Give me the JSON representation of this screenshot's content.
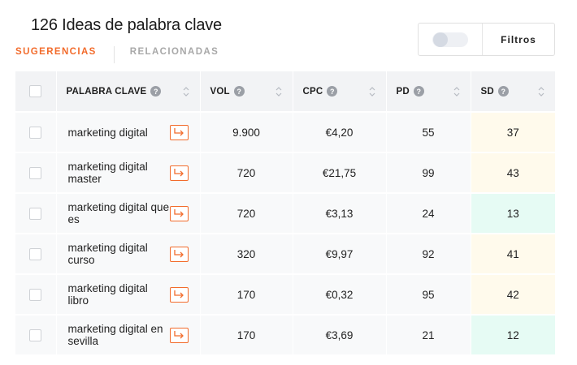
{
  "header": {
    "title": "126 Ideas de palabra clave"
  },
  "tabs": [
    {
      "label": "SUGERENCIAS",
      "active": true
    },
    {
      "label": "RELACIONADAS",
      "active": false
    }
  ],
  "filters": {
    "label": "Filtros",
    "toggle_on": false
  },
  "table": {
    "columns": [
      "PALABRA CLAVE",
      "VOL",
      "CPC",
      "PD",
      "SD"
    ],
    "rows": [
      {
        "keyword": "marketing digital",
        "vol": "9.900",
        "cpc": "€4,20",
        "pd": "55",
        "sd": "37",
        "sd_color": "#fffaec"
      },
      {
        "keyword": "marketing digital master",
        "vol": "720",
        "cpc": "€21,75",
        "pd": "99",
        "sd": "43",
        "sd_color": "#fffaec"
      },
      {
        "keyword": "marketing digital que es",
        "vol": "720",
        "cpc": "€3,13",
        "pd": "24",
        "sd": "13",
        "sd_color": "#e6fbf4"
      },
      {
        "keyword": "marketing digital curso",
        "vol": "320",
        "cpc": "€9,97",
        "pd": "92",
        "sd": "41",
        "sd_color": "#fffaec"
      },
      {
        "keyword": "marketing digital libro",
        "vol": "170",
        "cpc": "€0,32",
        "pd": "95",
        "sd": "42",
        "sd_color": "#fffaec"
      },
      {
        "keyword": "marketing digital en sevilla",
        "vol": "170",
        "cpc": "€3,69",
        "pd": "21",
        "sd": "12",
        "sd_color": "#e6fbf4"
      }
    ]
  },
  "colors": {
    "accent": "#f26b2b",
    "sd_medium": "#fffaec",
    "sd_easy": "#e6fbf4"
  },
  "icons": {
    "help": "question-circle-icon",
    "sort": "sort-arrows-icon",
    "keyword_link": "arrow-return-right-icon"
  }
}
